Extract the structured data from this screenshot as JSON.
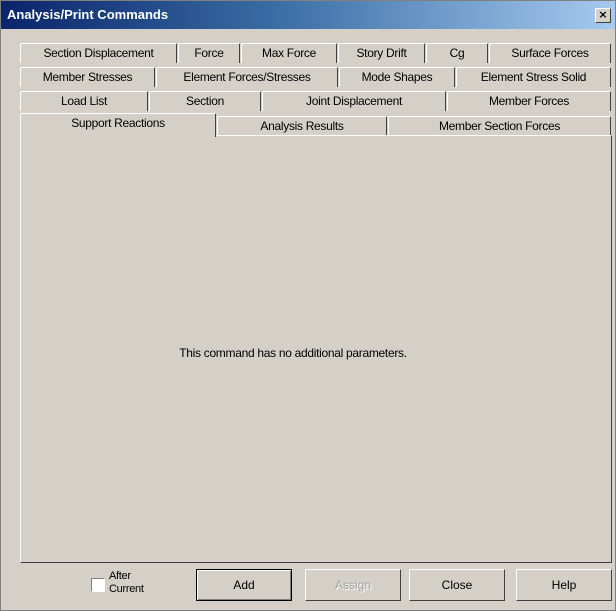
{
  "window": {
    "title": "Analysis/Print Commands",
    "close_symbol": "×"
  },
  "tabs": {
    "row1": [
      "Section Displacement",
      "Force",
      "Max Force",
      "Story Drift",
      "Cg",
      "Surface Forces"
    ],
    "row2": [
      "Member Stresses",
      "Element Forces/Stresses",
      "Mode Shapes",
      "Element Stress Solid"
    ],
    "row3": [
      "Load List",
      "Section",
      "Joint Displacement",
      "Member Forces"
    ],
    "row4": [
      "Support Reactions",
      "Analysis Results",
      "Member Section Forces"
    ],
    "active": "Support Reactions"
  },
  "panel": {
    "message": "This command has no additional parameters."
  },
  "footer": {
    "after_current_line1": "After",
    "after_current_line2": "Current",
    "after_current_checked": false,
    "add_label": "Add",
    "assign_label": "Assign",
    "close_label": "Close",
    "help_label": "Help"
  }
}
